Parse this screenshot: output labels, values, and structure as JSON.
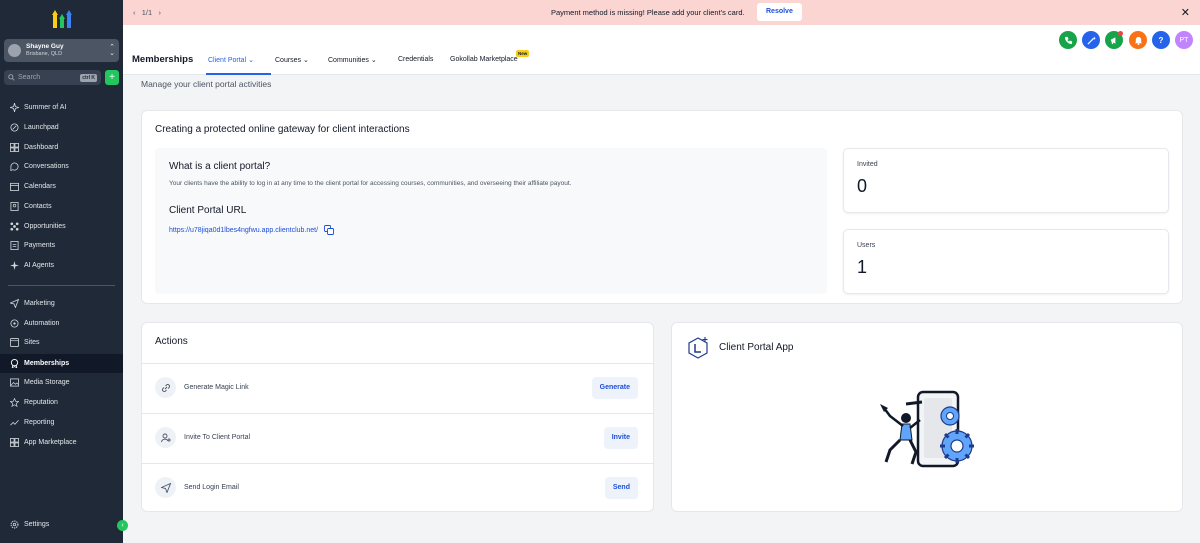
{
  "sidebar": {
    "account": {
      "name": "Shayne Guy",
      "location": "Brisbane, QLD"
    },
    "search": {
      "placeholder": "Search",
      "shortcut": "ctrl K"
    },
    "items": [
      {
        "label": "Summer of AI",
        "icon": "sparkle-icon"
      },
      {
        "label": "Launchpad",
        "icon": "rocket-icon"
      },
      {
        "label": "Dashboard",
        "icon": "dashboard-icon"
      },
      {
        "label": "Conversations",
        "icon": "chat-icon"
      },
      {
        "label": "Calendars",
        "icon": "calendar-icon"
      },
      {
        "label": "Contacts",
        "icon": "contacts-icon"
      },
      {
        "label": "Opportunities",
        "icon": "opportunities-icon"
      },
      {
        "label": "Payments",
        "icon": "payments-icon"
      },
      {
        "label": "AI Agents",
        "icon": "ai-agents-icon"
      },
      {
        "label": "Marketing",
        "icon": "send-icon"
      },
      {
        "label": "Automation",
        "icon": "automation-icon"
      },
      {
        "label": "Sites",
        "icon": "sites-icon"
      },
      {
        "label": "Memberships",
        "icon": "memberships-icon"
      },
      {
        "label": "Media Storage",
        "icon": "media-icon"
      },
      {
        "label": "Reputation",
        "icon": "star-icon"
      },
      {
        "label": "Reporting",
        "icon": "chart-icon"
      },
      {
        "label": "App Marketplace",
        "icon": "marketplace-icon"
      }
    ],
    "settings": "Settings",
    "active": "Memberships"
  },
  "banner": {
    "pager": "1/1",
    "message": "Payment method is missing! Please add your client's card.",
    "resolve": "Resolve"
  },
  "header": {
    "title": "Memberships",
    "tabs": [
      {
        "label": "Client Portal"
      },
      {
        "label": "Courses"
      },
      {
        "label": "Communities"
      },
      {
        "label": "Credentials"
      },
      {
        "label": "Gokollab Marketplace"
      }
    ],
    "new_badge": "New",
    "avatar": "PT",
    "colors": {
      "accent": "#2563eb",
      "phone": "#16a34a",
      "megaphone": "#16a34a",
      "bell": "#f97316"
    }
  },
  "page": {
    "subtitle": "Manage your client portal activities",
    "gateway_title": "Creating a protected online gateway for client interactions",
    "what_title": "What is a client portal?",
    "what_desc": "Your clients have the ability to log in at any time to the client portal for accessing courses, communities, and overseeing their affiliate payout.",
    "url_title": "Client Portal URL",
    "url": "https://u78jiqa0d1lbes4ngfwu.app.clientclub.net/",
    "stats": [
      {
        "label": "Invited",
        "value": "0"
      },
      {
        "label": "Users",
        "value": "1"
      }
    ],
    "actions_title": "Actions",
    "actions": [
      {
        "label": "Generate Magic Link",
        "button": "Generate"
      },
      {
        "label": "Invite To Client Portal",
        "button": "Invite"
      },
      {
        "label": "Send Login Email",
        "button": "Send"
      }
    ],
    "app_title": "Client Portal App"
  }
}
